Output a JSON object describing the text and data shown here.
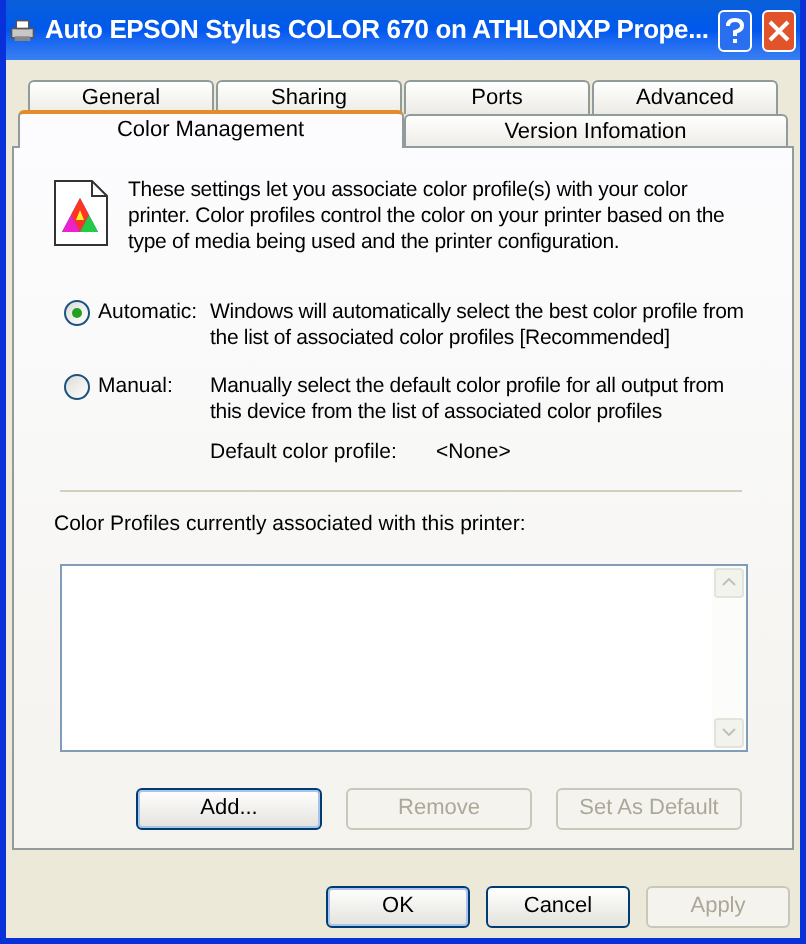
{
  "window": {
    "title": "Auto EPSON Stylus COLOR 670 on ATHLONXP Prope..."
  },
  "tab_rows": [
    {
      "tabs": [
        {
          "label": "General",
          "selected": false
        },
        {
          "label": "Sharing",
          "selected": false
        },
        {
          "label": "Ports",
          "selected": false
        },
        {
          "label": "Advanced",
          "selected": false
        }
      ]
    },
    {
      "tabs": [
        {
          "label": "Color Management",
          "selected": true
        },
        {
          "label": "Version Infomation",
          "selected": false
        }
      ]
    }
  ],
  "intro": "These settings let you associate color profile(s) with your color printer. Color profiles control the color on your printer based on the type of media being used and the printer configuration.",
  "options": [
    {
      "label": "Automatic:",
      "description": "Windows will automatically select the best color profile from the list of associated color profiles [Recommended]",
      "selected": true
    },
    {
      "label": "Manual:",
      "description": "Manually select the default color profile for all output from this device from the list of associated color profiles",
      "selected": false
    }
  ],
  "default_profile": {
    "label": "Default color profile:",
    "value": "<None>"
  },
  "profiles_label": "Color Profiles currently associated with this printer:",
  "profile_buttons": [
    {
      "label": "Add...",
      "disabled": false,
      "default": true
    },
    {
      "label": "Remove",
      "disabled": true,
      "default": false
    },
    {
      "label": "Set As Default",
      "disabled": true,
      "default": false
    }
  ],
  "dialog_buttons": [
    {
      "label": "OK",
      "disabled": false,
      "default": true
    },
    {
      "label": "Cancel",
      "disabled": false,
      "default": false
    },
    {
      "label": "Apply",
      "disabled": true,
      "default": false
    }
  ]
}
